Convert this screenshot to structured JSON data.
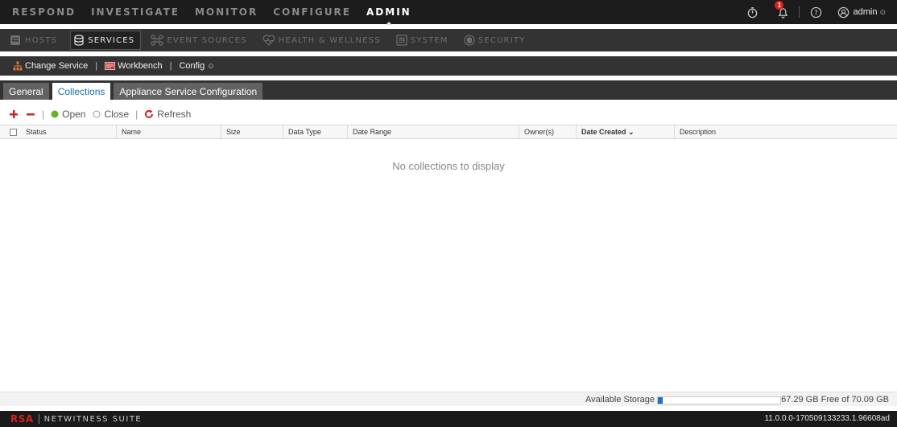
{
  "topnav": {
    "items": [
      "RESPOND",
      "INVESTIGATE",
      "MONITOR",
      "CONFIGURE",
      "ADMIN"
    ],
    "active": "ADMIN",
    "notification_count": "1",
    "user": "admin"
  },
  "subnav": {
    "items": [
      {
        "label": "HOSTS",
        "icon": "hosts-icon"
      },
      {
        "label": "SERVICES",
        "icon": "services-icon"
      },
      {
        "label": "EVENT SOURCES",
        "icon": "event-sources-icon"
      },
      {
        "label": "HEALTH & WELLNESS",
        "icon": "health-icon"
      },
      {
        "label": "SYSTEM",
        "icon": "system-icon"
      },
      {
        "label": "SECURITY",
        "icon": "security-icon"
      }
    ],
    "active": "SERVICES"
  },
  "service_toolbar": {
    "change_service": "Change Service",
    "workbench": "Workbench",
    "config": "Config"
  },
  "tabs": [
    "General",
    "Collections",
    "Appliance Service Configuration"
  ],
  "active_tab": "Collections",
  "actions": {
    "open": "Open",
    "close": "Close",
    "refresh": "Refresh"
  },
  "table": {
    "columns": [
      "Status",
      "Name",
      "Size",
      "Data Type",
      "Date Range",
      "Owner(s)",
      "Date Created",
      "Description"
    ],
    "sorted_column": "Date Created",
    "empty_message": "No collections to display"
  },
  "storage": {
    "label": "Available Storage",
    "used_fraction": 0.04,
    "free_text": "67.29 GB Free of 70.09 GB"
  },
  "footer": {
    "brand": "RSA",
    "product": "NETWITNESS SUITE",
    "version": "11.0.0.0-170509133233.1.96608ad"
  },
  "colors": {
    "brand_red": "#d9201c",
    "accent_blue": "#1e73be",
    "open_green": "#6ab023"
  }
}
